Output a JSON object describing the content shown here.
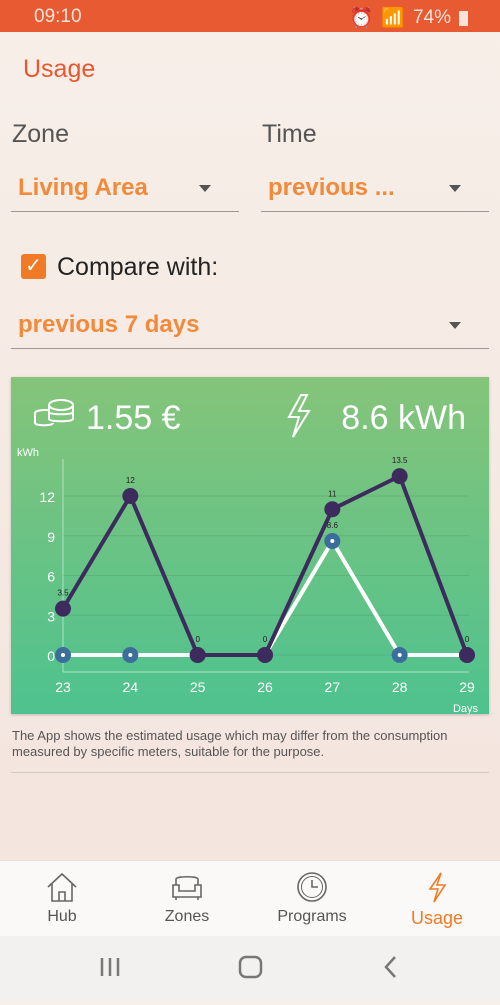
{
  "status": {
    "time": "09:10",
    "battery": "74%"
  },
  "title": "Usage",
  "zone": {
    "label": "Zone",
    "value": "Living Area"
  },
  "time": {
    "label": "Time",
    "value": "previous ..."
  },
  "compare": {
    "label": "Compare with:",
    "checked": true,
    "value": "previous 7 days"
  },
  "summary": {
    "cost": "1.55 €",
    "energy": "8.6 kWh"
  },
  "note": "The App shows the estimated usage which may differ from the consumption measured by specific meters, suitable for the purpose.",
  "nav": [
    {
      "label": "Hub",
      "icon": "home-icon"
    },
    {
      "label": "Zones",
      "icon": "sofa-icon"
    },
    {
      "label": "Programs",
      "icon": "clock-icon"
    },
    {
      "label": "Usage",
      "icon": "lightning-icon",
      "active": true
    }
  ],
  "chart_data": {
    "type": "line",
    "xlabel": "Days",
    "ylabel": "kWh",
    "x": [
      "23",
      "24",
      "25",
      "26",
      "27",
      "28",
      "29"
    ],
    "yticks": [
      0,
      3,
      6,
      9,
      12
    ],
    "ylim": [
      -1,
      14.5
    ],
    "series": [
      {
        "values": [
          3.5,
          12,
          0,
          0,
          11,
          13.5,
          0
        ],
        "color": "#3d2b5e"
      },
      {
        "values": [
          0,
          0,
          0,
          0,
          8.6,
          0,
          0
        ],
        "color": "#ffffff"
      }
    ],
    "grid": true
  },
  "colors": {
    "accent": "#e8572f",
    "status_bar": "#e85a32"
  }
}
